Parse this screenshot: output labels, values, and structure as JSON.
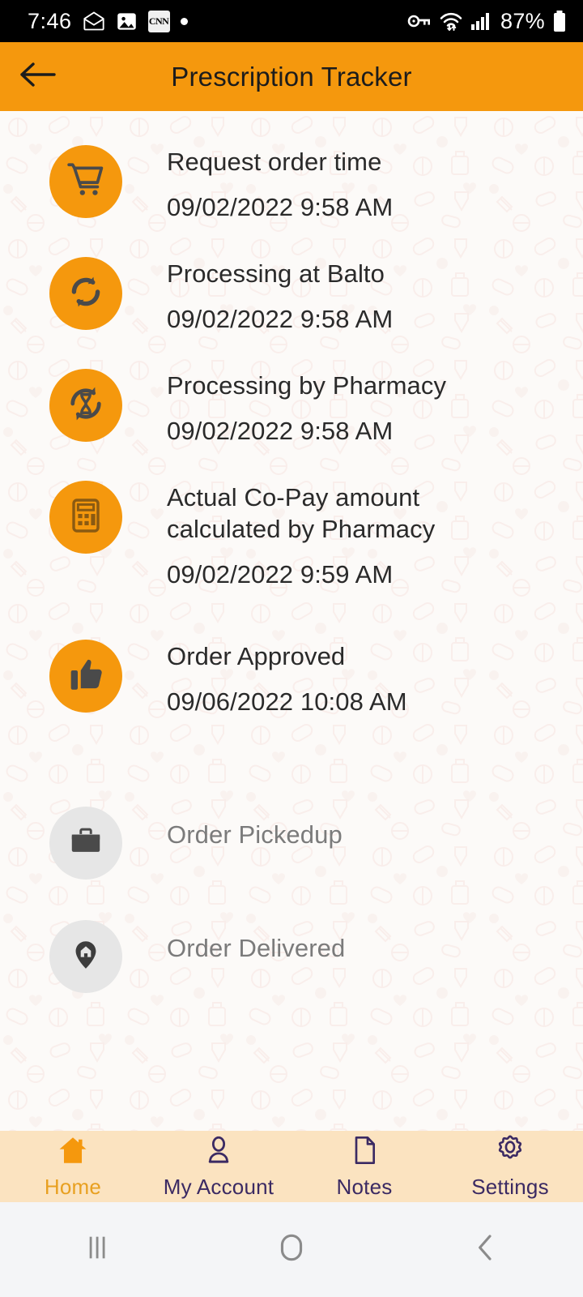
{
  "status_bar": {
    "time": "7:46",
    "battery_percent": "87%",
    "left_icons": [
      "envelope-icon",
      "gallery-icon",
      "cnn-icon",
      "dot-indicator"
    ],
    "cnn_label": "CNN",
    "right_icons": [
      "vpn-key-icon",
      "wifi-icon",
      "signal-icon",
      "battery-icon"
    ]
  },
  "app_bar": {
    "title": "Prescription Tracker",
    "back_icon": "arrow-left-icon",
    "background_color": "#F5980D"
  },
  "theme": {
    "accent": "#F5980D",
    "inactive": "#E6E6E6",
    "text": "#2a2a2a",
    "muted_text": "#7b7b7b",
    "nav_bg": "#FBE3C0",
    "nav_text": "#3B2A63",
    "nav_active": "#E8A020"
  },
  "timeline": {
    "steps": [
      {
        "icon": "shopping-cart-icon",
        "label": "Request order time",
        "date": "09/02/2022 9:58 AM",
        "state": "completed"
      },
      {
        "icon": "sync-icon",
        "label": "Processing at Balto",
        "date": "09/02/2022 9:58 AM",
        "state": "completed"
      },
      {
        "icon": "hourglass-sync-icon",
        "label": "Processing by Pharmacy",
        "date": "09/02/2022 9:58 AM",
        "state": "completed"
      },
      {
        "icon": "calculator-icon",
        "label": "Actual Co-Pay amount calculated by Pharmacy",
        "date": "09/02/2022 9:59 AM",
        "state": "completed"
      },
      {
        "icon": "thumbs-up-icon",
        "label": "Order Approved",
        "date": "09/06/2022 10:08 AM",
        "state": "completed"
      },
      {
        "icon": "briefcase-icon",
        "label": "Order Pickedup",
        "date": "",
        "state": "pending"
      },
      {
        "icon": "map-pin-home-icon",
        "label": "Order Delivered",
        "date": "",
        "state": "pending"
      }
    ]
  },
  "bottom_nav": {
    "items": [
      {
        "label": "Home",
        "icon": "home-icon",
        "active": true
      },
      {
        "label": "My Account",
        "icon": "person-icon",
        "active": false
      },
      {
        "label": "Notes",
        "icon": "document-icon",
        "active": false
      },
      {
        "label": "Settings",
        "icon": "gear-icon",
        "active": false
      }
    ]
  },
  "android_nav": {
    "recents": "recents-icon",
    "home": "home-circle-icon",
    "back": "back-chevron-icon"
  }
}
